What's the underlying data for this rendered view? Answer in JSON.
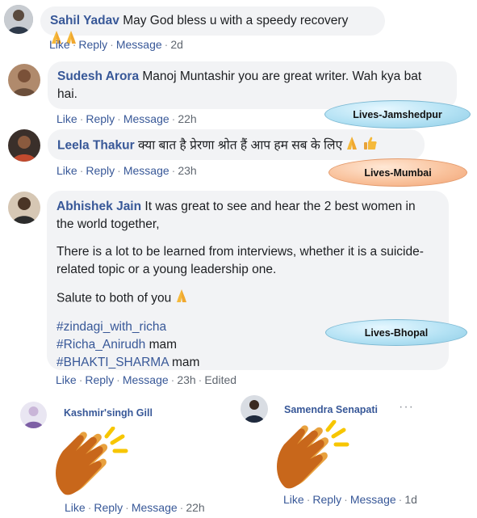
{
  "comments": [
    {
      "author": "Sahil Yadav",
      "text": "May God bless u with a speedy recovery",
      "actions": {
        "like": "Like",
        "reply": "Reply",
        "message": "Message",
        "time": "2d"
      }
    },
    {
      "author": "Sudesh Arora",
      "text_line1": "Manoj Muntashir you are great writer. Wah kya bat",
      "text_line2": "hai.",
      "actions": {
        "like": "Like",
        "reply": "Reply",
        "message": "Message",
        "time": "22h"
      }
    },
    {
      "author": "Leela Thakur",
      "text": "क्या बात है प्रेरणा श्रोत हैं आप हम सब के लिए",
      "actions": {
        "like": "Like",
        "reply": "Reply",
        "message": "Message",
        "time": "23h"
      }
    },
    {
      "author": "Abhishek Jain",
      "p1_line1": "It was great to see and hear the 2 best women in",
      "p1_line2": "the world together,",
      "p2_line1": "There is a lot to be learned from interviews, whether it is a suicide-",
      "p2_line2": "related topic or a young leadership one.",
      "p3": "Salute to both of you",
      "hashtag1": "#zindagi_with_richa",
      "hashtag2": "#Richa_Anirudh",
      "hashtag2_suffix": "mam",
      "hashtag3": "#BHAKTI_SHARMA",
      "hashtag3_suffix": "mam",
      "actions": {
        "like": "Like",
        "reply": "Reply",
        "message": "Message",
        "time": "23h",
        "edited": "Edited"
      }
    }
  ],
  "clap_comments": [
    {
      "author": "Kashmir'singh Gill",
      "actions": {
        "like": "Like",
        "reply": "Reply",
        "message": "Message",
        "time": "22h"
      }
    },
    {
      "author": "Samendra Senapati",
      "more": "···",
      "actions": {
        "like": "Like",
        "reply": "Reply",
        "message": "Message",
        "time": "1d"
      }
    }
  ],
  "labels": {
    "jamshedpur": "Lives-Jamshedpur",
    "mumbai": "Lives-Mumbai",
    "bhopal": "Lives-Bhopal"
  },
  "separator": "·",
  "icons": [
    "folded-hands-icon",
    "thumbs-up-icon",
    "clapping-hands-icon",
    "more-options-icon"
  ]
}
